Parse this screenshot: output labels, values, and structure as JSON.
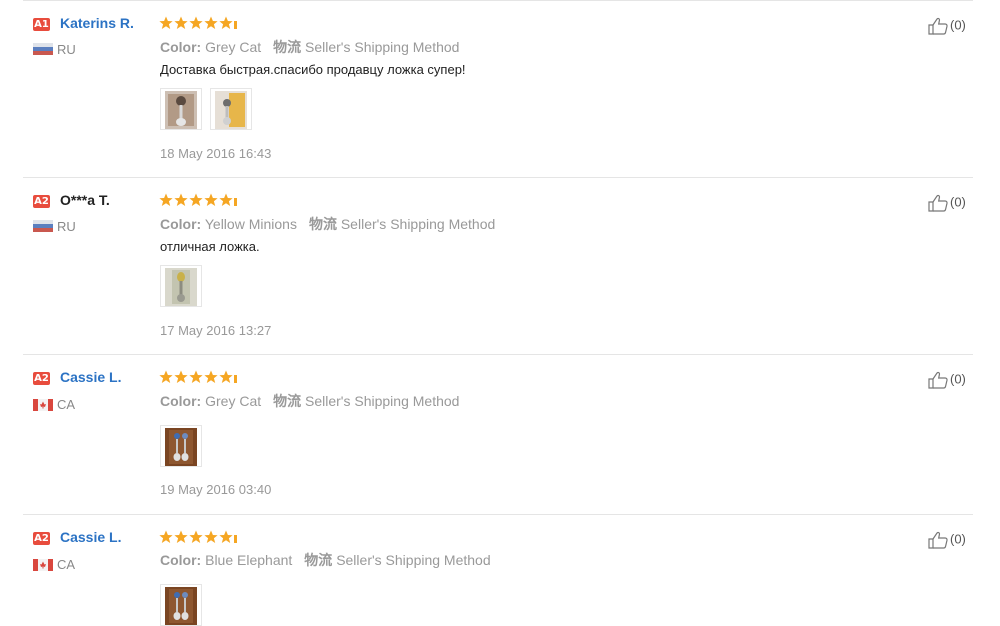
{
  "colors": {
    "badge": "#e84c3d",
    "name_link": "#2c73c4",
    "star": "#f5a623",
    "muted": "#999999",
    "divider": "#e5e5e5"
  },
  "labels": {
    "color": "Color:",
    "logistics": "物流",
    "shipping": "Seller's Shipping Method"
  },
  "reviews": [
    {
      "badge": "A1",
      "name": "Katerins R.",
      "name_style": "link",
      "country": "RU",
      "flag": "russia-flag-icon",
      "rating_stars": 5,
      "color_value": "Grey Cat",
      "comment": "Доставка быстрая.спасибо продавцу ложка супер!",
      "photos": [
        "review-photo-spoon-grey-cat-1",
        "review-photo-spoon-grey-cat-2"
      ],
      "date": "18 May 2016 16:43",
      "likes": "(0)"
    },
    {
      "badge": "A2",
      "name": "O***a T.",
      "name_style": "plain",
      "country": "RU",
      "flag": "russia-flag-icon",
      "rating_stars": 5,
      "color_value": "Yellow Minions",
      "comment": "отличная ложка.",
      "photos": [
        "review-photo-spoon-minion"
      ],
      "date": "17 May 2016 13:27",
      "likes": "(0)"
    },
    {
      "badge": "A2",
      "name": "Cassie L.",
      "name_style": "link",
      "country": "CA",
      "flag": "canada-flag-icon",
      "rating_stars": 5,
      "color_value": "Grey Cat",
      "comment": "",
      "photos": [
        "review-photo-spoon-pair-1"
      ],
      "date": "19 May 2016 03:40",
      "likes": "(0)"
    },
    {
      "badge": "A2",
      "name": "Cassie L.",
      "name_style": "link",
      "country": "CA",
      "flag": "canada-flag-icon",
      "rating_stars": 5,
      "color_value": "Blue Elephant",
      "comment": "",
      "photos": [
        "review-photo-spoon-pair-2"
      ],
      "date": "",
      "likes": "(0)"
    }
  ]
}
